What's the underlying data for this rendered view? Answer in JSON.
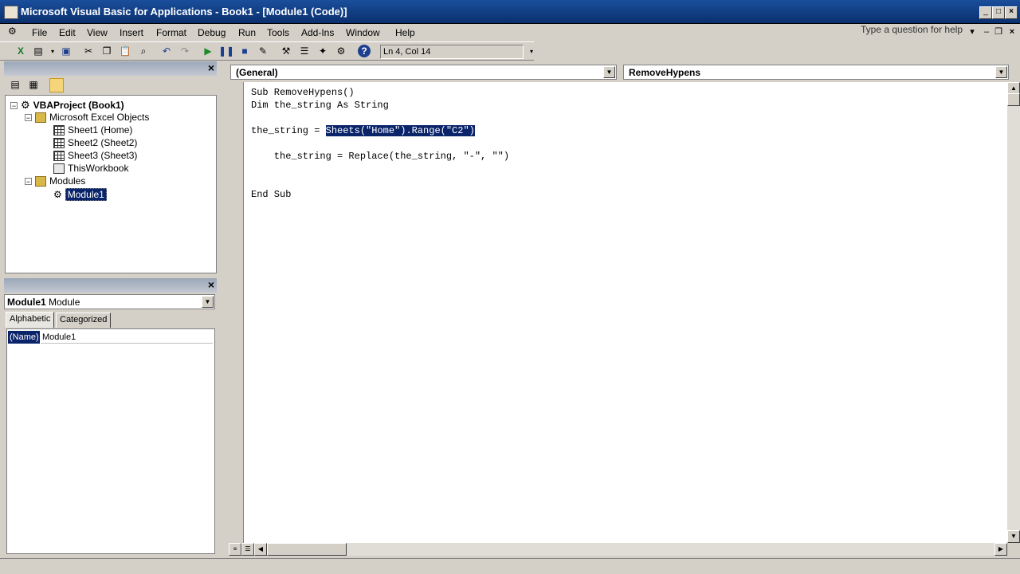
{
  "window": {
    "title": "Microsoft Visual Basic for Applications - Book1 - [Module1 (Code)]"
  },
  "menu": {
    "items": [
      "File",
      "Edit",
      "View",
      "Insert",
      "Format",
      "Debug",
      "Run",
      "Tools",
      "Add-Ins",
      "Window",
      "Help"
    ],
    "help_placeholder": "Type a question for help"
  },
  "toolbar": {
    "cursor_position": "Ln 4, Col 14"
  },
  "project": {
    "root": "VBAProject (Book1)",
    "excel_objects": "Microsoft Excel Objects",
    "sheets": [
      "Sheet1 (Home)",
      "Sheet2 (Sheet2)",
      "Sheet3 (Sheet3)",
      "ThisWorkbook"
    ],
    "modules_folder": "Modules",
    "module": "Module1"
  },
  "properties": {
    "object_name": "Module1",
    "object_type": "Module",
    "tabs": [
      "Alphabetic",
      "Categorized"
    ],
    "row_key": "(Name)",
    "row_value": "Module1"
  },
  "code": {
    "object_combo": "(General)",
    "proc_combo": "RemoveHypens",
    "lines": {
      "l1": "Sub RemoveHypens()",
      "l2": "Dim the_string As String",
      "l3_pre": "the_string = ",
      "l3_sel": "Sheets(\"Home\").Range(\"C2\")",
      "l4": "    the_string = Replace(the_string, \"-\", \"\")",
      "l5": "End Sub"
    }
  }
}
